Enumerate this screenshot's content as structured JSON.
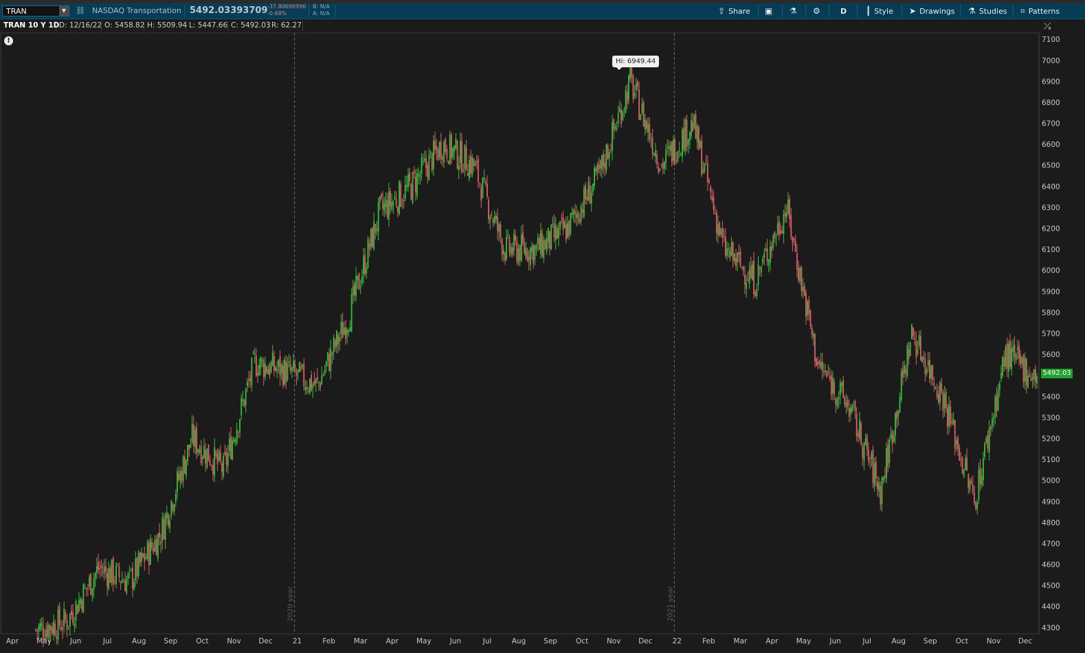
{
  "toolbar": {
    "symbol": "TRAN",
    "instrument_name": "NASDAQ Transportation",
    "last_price": "5492.03393709",
    "change_abs": "-37.80696996",
    "change_pct": "-0.68%",
    "bid": "B: N/A",
    "ask": "A: N/A",
    "share_label": "Share",
    "aggregation": "D",
    "style_label": "Style",
    "drawings_label": "Drawings",
    "studies_label": "Studies",
    "patterns_label": "Patterns",
    "icons": [
      "link-icon",
      "share-icon",
      "flexible-grid-icon",
      "beaker-icon",
      "gear-icon",
      "candle-style-icon",
      "pointer-icon",
      "flask-icon",
      "patterns-icon"
    ]
  },
  "info": {
    "title": "TRAN 10 Y 1D",
    "date": "D: 12/16/22",
    "open": "O: 5458.82",
    "high": "H: 5509.94",
    "low": "L: 5447.66",
    "close": "C: 5492.03",
    "range": "R: 62.27"
  },
  "chart_data": {
    "type": "candlestick",
    "title": "",
    "xlabel": "",
    "ylabel": "",
    "ylim": [
      4270,
      7130
    ],
    "yticks": [
      4300,
      4400,
      4500,
      4600,
      4700,
      4800,
      4900,
      5000,
      5100,
      5200,
      5300,
      5400,
      5500,
      5600,
      5700,
      5800,
      5900,
      6000,
      6100,
      6200,
      6300,
      6400,
      6500,
      6600,
      6700,
      6800,
      6900,
      7000,
      7100
    ],
    "xticks": [
      "Apr",
      "May",
      "Jun",
      "Jul",
      "Aug",
      "Sep",
      "Oct",
      "Nov",
      "Dec",
      "21",
      "Feb",
      "Mar",
      "Apr",
      "May",
      "Jun",
      "Jul",
      "Aug",
      "Sep",
      "Oct",
      "Nov",
      "Dec",
      "22",
      "Feb",
      "Mar",
      "Apr",
      "May",
      "Jun",
      "Jul",
      "Aug",
      "Sep",
      "Oct",
      "Nov",
      "Dec"
    ],
    "year_markers": [
      "2020 year",
      "2021 year"
    ],
    "high_label": "Hi: 6949.44",
    "last_label": "5492.03",
    "colors": {
      "up": "#3cbf3c",
      "down": "#e0606a",
      "background": "#1b1b1b",
      "last_price_bg": "#1fa32e"
    },
    "series": [
      {
        "close_by_month": [
          4290,
          4330,
          4580,
          4520,
          4750,
          5200,
          5050,
          5560,
          5520,
          5450,
          5780,
          6280,
          6400,
          6600,
          6500,
          6100,
          6100,
          6200,
          6450,
          6900,
          6500,
          6700,
          6100,
          5950,
          6300,
          5550,
          5350,
          4950,
          5700,
          5400,
          4900,
          5600,
          5490
        ]
      }
    ]
  }
}
